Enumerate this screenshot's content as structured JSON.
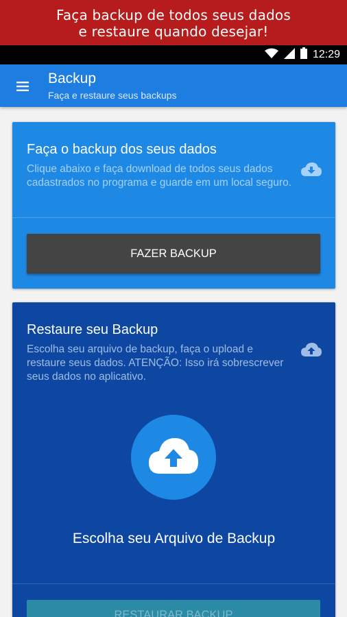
{
  "promo": {
    "line1": "Faça backup de todos seus dados",
    "line2": "e restaure quando desejar!"
  },
  "status_bar": {
    "time": "12:29",
    "icons": [
      "wifi-icon",
      "signal-icon",
      "battery-icon"
    ]
  },
  "app_bar": {
    "title": "Backup",
    "subtitle": "Faça e restaure seus backups",
    "menu_icon": "hamburger-menu-icon"
  },
  "backup_card": {
    "title": "Faça o backup dos seus dados",
    "description": "Clique abaixo e faça download de todos seus dados cadastrados no programa e guarde em um local seguro.",
    "icon": "cloud-download-icon",
    "button_label": "FAZER BACKUP"
  },
  "restore_card": {
    "title": "Restaure seu Backup",
    "description": "Escolha seu arquivo de backup, faça o upload e restaure seus dados. ATENÇÃO: Isso irá sobrescrever seus dados no aplicativo.",
    "icon": "cloud-upload-icon",
    "upload_icon": "cloud-upload-icon",
    "choose_label": "Escolha seu Arquivo de Backup",
    "button_label": "RESTAURAR BACKUP"
  },
  "colors": {
    "promo_bg": "#b71c1c",
    "app_bar": "#1e7de0",
    "backup_card": "#1e88e5",
    "restore_card": "#0d47a1",
    "backup_button": "#444444",
    "restore_button": "#2b8aa5"
  }
}
